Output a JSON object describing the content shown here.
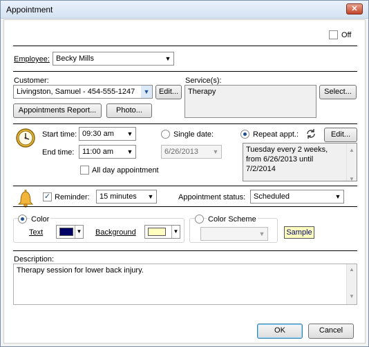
{
  "window": {
    "title": "Appointment",
    "close_glyph": "✕"
  },
  "off_label": "Off",
  "employee": {
    "label": "Employee:",
    "value": "Becky  Mills"
  },
  "customer": {
    "label": "Customer:",
    "value": "Livingston, Samuel - 454-555-1247",
    "edit_label": "Edit...",
    "appointments_report_label": "Appointments Report...",
    "photo_label": "Photo..."
  },
  "services": {
    "label": "Service(s):",
    "value": "Therapy",
    "select_label": "Select..."
  },
  "time": {
    "start_label": "Start time:",
    "start_value": "09:30 am",
    "end_label": "End time:",
    "end_value": "11:00 am",
    "all_day_label": "All day appointment",
    "single_date_label": "Single date:",
    "single_date_value": "6/26/2013",
    "repeat_label": "Repeat appt.:",
    "repeat_edit_label": "Edit...",
    "repeat_description": "Tuesday every 2 weeks, from 6/26/2013 until 7/2/2014"
  },
  "reminder": {
    "label": "Reminder:",
    "value": "15 minutes",
    "status_label": "Appointment status:",
    "status_value": "Scheduled"
  },
  "colors": {
    "color_label": "Color",
    "text_label": "Text",
    "text_color": "#000066",
    "background_label": "Background",
    "background_color": "#ffffc0",
    "color_scheme_label": "Color Scheme",
    "sample_label": "Sample"
  },
  "description": {
    "label": "Description:",
    "value": "Therapy session for lower back injury."
  },
  "footer": {
    "ok_label": "OK",
    "cancel_label": "Cancel"
  }
}
